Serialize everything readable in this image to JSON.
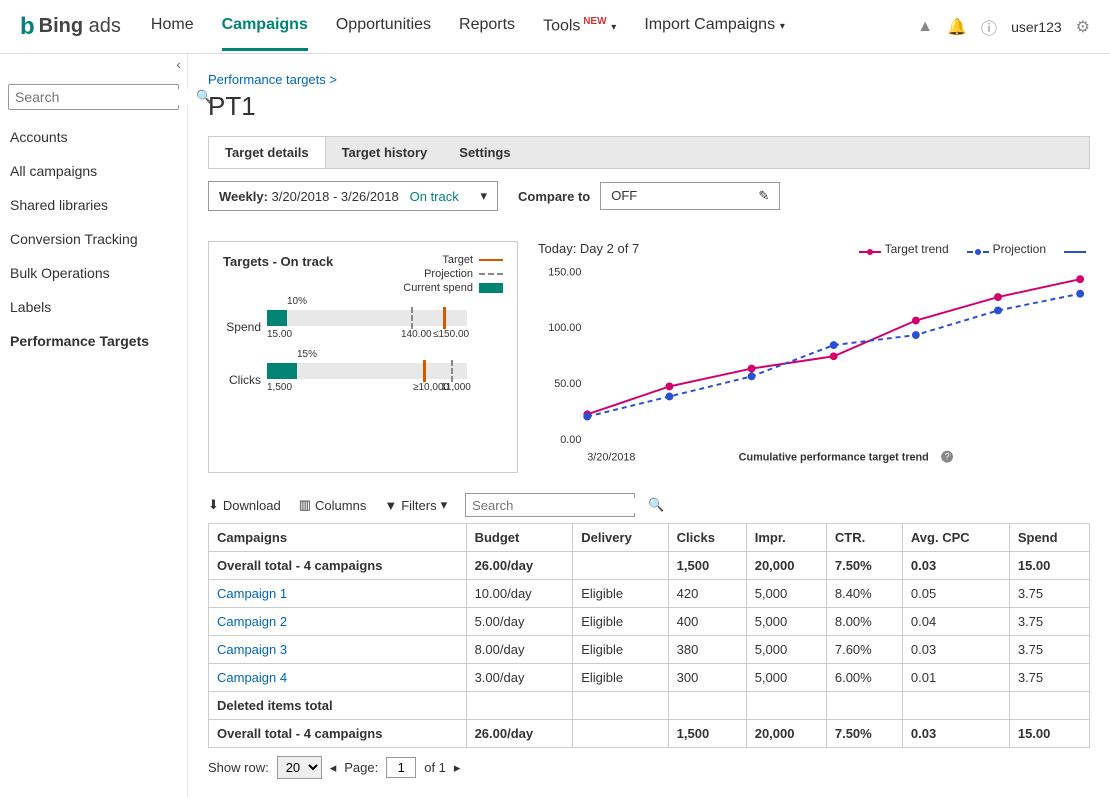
{
  "brand": {
    "name": "Bing",
    "suffix": "ads"
  },
  "topnav": {
    "items": [
      "Home",
      "Campaigns",
      "Opportunities",
      "Reports",
      "Tools",
      "Import Campaigns"
    ],
    "new_badge": "NEW",
    "active_index": 1
  },
  "user": {
    "name": "user123"
  },
  "sidebar": {
    "search_placeholder": "Search",
    "items": [
      "Accounts",
      "All campaigns",
      "Shared libraries",
      "Conversion Tracking",
      "Bulk Operations",
      "Labels",
      "Performance Targets"
    ],
    "active_index": 6
  },
  "breadcrumb": {
    "parent": "Performance targets",
    "sep": ">"
  },
  "page": {
    "title": "PT1"
  },
  "tabs": {
    "items": [
      "Target details",
      "Target history",
      "Settings"
    ],
    "active_index": 0
  },
  "period_selector": {
    "label": "Weekly:",
    "range": "3/20/2018 - 3/26/2018",
    "status": "On track"
  },
  "compare": {
    "label": "Compare to",
    "value": "OFF"
  },
  "targets_panel": {
    "title": "Targets - On track",
    "legend": {
      "target": "Target",
      "projection": "Projection",
      "current": "Current spend"
    },
    "rows": [
      {
        "label": "Spend",
        "pct": "10%",
        "fill": 0.1,
        "low": "15.00",
        "proj_pos": 0.72,
        "proj_label": "140.00",
        "target_pos": 0.88,
        "target_label": "≤150.00"
      },
      {
        "label": "Clicks",
        "pct": "15%",
        "fill": 0.15,
        "low": "1,500",
        "proj_pos": 0.92,
        "proj_label": "11,000",
        "target_pos": 0.78,
        "target_label": "≥10,000"
      }
    ]
  },
  "chart": {
    "today_label": "Today: Day 2 of 7",
    "legend": {
      "trend": "Target trend",
      "projection": "Projection"
    },
    "x_axis_label": "Cumulative performance target trend",
    "x_start": "3/20/2018"
  },
  "chart_data": {
    "type": "line",
    "x": [
      1,
      2,
      3,
      4,
      5,
      6,
      7
    ],
    "ylim": [
      0,
      150
    ],
    "yticks": [
      0.0,
      50.0,
      100.0,
      150.0
    ],
    "series": [
      {
        "name": "Target trend",
        "values": [
          22,
          47,
          63,
          74,
          106,
          127,
          143
        ],
        "color": "#d4006b",
        "style": "solid"
      },
      {
        "name": "Projection",
        "values": [
          20,
          38,
          56,
          84,
          93,
          115,
          130
        ],
        "color": "#2b4fd1",
        "style": "dashed"
      }
    ],
    "x_start_label": "3/20/2018"
  },
  "toolbar": {
    "download": "Download",
    "columns": "Columns",
    "filters": "Filters",
    "search_placeholder": "Search"
  },
  "table": {
    "headers": [
      "Campaigns",
      "Budget",
      "Delivery",
      "Clicks",
      "Impr.",
      "CTR.",
      "Avg. CPC",
      "Spend"
    ],
    "overall_label": "Overall total - 4 campaigns",
    "overall": {
      "budget": "26.00/day",
      "delivery": "",
      "clicks": "1,500",
      "impr": "20,000",
      "ctr": "7.50%",
      "cpc": "0.03",
      "spend": "15.00"
    },
    "rows": [
      {
        "name": "Campaign 1",
        "budget": "10.00/day",
        "delivery": "Eligible",
        "clicks": "420",
        "impr": "5,000",
        "ctr": "8.40%",
        "cpc": "0.05",
        "spend": "3.75"
      },
      {
        "name": "Campaign 2",
        "budget": "5.00/day",
        "delivery": "Eligible",
        "clicks": "400",
        "impr": "5,000",
        "ctr": "8.00%",
        "cpc": "0.04",
        "spend": "3.75"
      },
      {
        "name": "Campaign 3",
        "budget": "8.00/day",
        "delivery": "Eligible",
        "clicks": "380",
        "impr": "5,000",
        "ctr": "7.60%",
        "cpc": "0.03",
        "spend": "3.75"
      },
      {
        "name": "Campaign 4",
        "budget": "3.00/day",
        "delivery": "Eligible",
        "clicks": "300",
        "impr": "5,000",
        "ctr": "6.00%",
        "cpc": "0.01",
        "spend": "3.75"
      }
    ],
    "deleted_label": "Deleted items total"
  },
  "pager": {
    "show_row": "Show row:",
    "page_size": "20",
    "page_label": "Page:",
    "page": "1",
    "of": "of 1"
  }
}
